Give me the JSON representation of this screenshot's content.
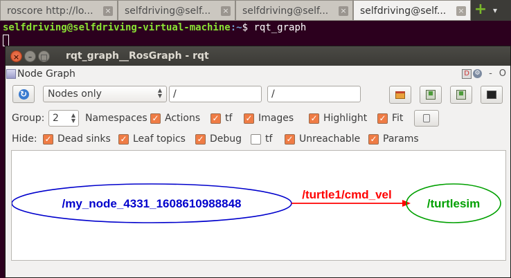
{
  "tabs": [
    {
      "label": "roscore http://lo...",
      "active": false
    },
    {
      "label": "selfdriving@self...",
      "active": false
    },
    {
      "label": "selfdriving@self...",
      "active": false
    },
    {
      "label": "selfdriving@self...",
      "active": true
    }
  ],
  "tab_close_glyph": "×",
  "terminal": {
    "user_host": "selfdriving@selfdriving-virtual-machine",
    "path": ":~",
    "symbol": "$",
    "command": " rqt_graph",
    "colors": {
      "background": "#2c001e",
      "user": "#8ae234",
      "path": "#729fcf"
    }
  },
  "window": {
    "title": "rqt_graph__RosGraph - rqt",
    "panel_title": "Node Graph",
    "panel_right": {
      "help": "D",
      "dash": "-",
      "letter": "O"
    }
  },
  "toolbar": {
    "mode_select": "Nodes only",
    "filter1": "/",
    "filter2": "/"
  },
  "group_row": {
    "group_label": "Group:",
    "group_value": "2",
    "options": [
      {
        "label": "Namespaces",
        "checked": null
      },
      {
        "label": "Actions",
        "checked": true
      },
      {
        "label": "tf",
        "checked": true
      },
      {
        "label": "Images",
        "checked": true
      },
      {
        "label": "Highlight",
        "checked": true
      },
      {
        "label": "Fit",
        "checked": true
      }
    ]
  },
  "hide_row": {
    "hide_label": "Hide:",
    "options": [
      {
        "label": "Dead sinks",
        "checked": true
      },
      {
        "label": "Leaf topics",
        "checked": true
      },
      {
        "label": "Debug",
        "checked": true
      },
      {
        "label": "tf",
        "checked": false
      },
      {
        "label": "Unreachable",
        "checked": true
      },
      {
        "label": "Params",
        "checked": true
      }
    ]
  },
  "graph": {
    "source_node": "/my_node_4331_1608610988848",
    "target_node": "/turtlesim",
    "topic": "/turtle1/cmd_vel",
    "colors": {
      "source": "#0000cc",
      "target": "#00a000",
      "edge": "#ff0000"
    }
  },
  "accent": "#ef7c45",
  "check_glyph": "✓",
  "icons": {
    "refresh": "refresh-icon",
    "load": "folder-open-icon",
    "save": "save-icon",
    "export": "export-image-icon",
    "screenshot": "screenshot-icon"
  }
}
